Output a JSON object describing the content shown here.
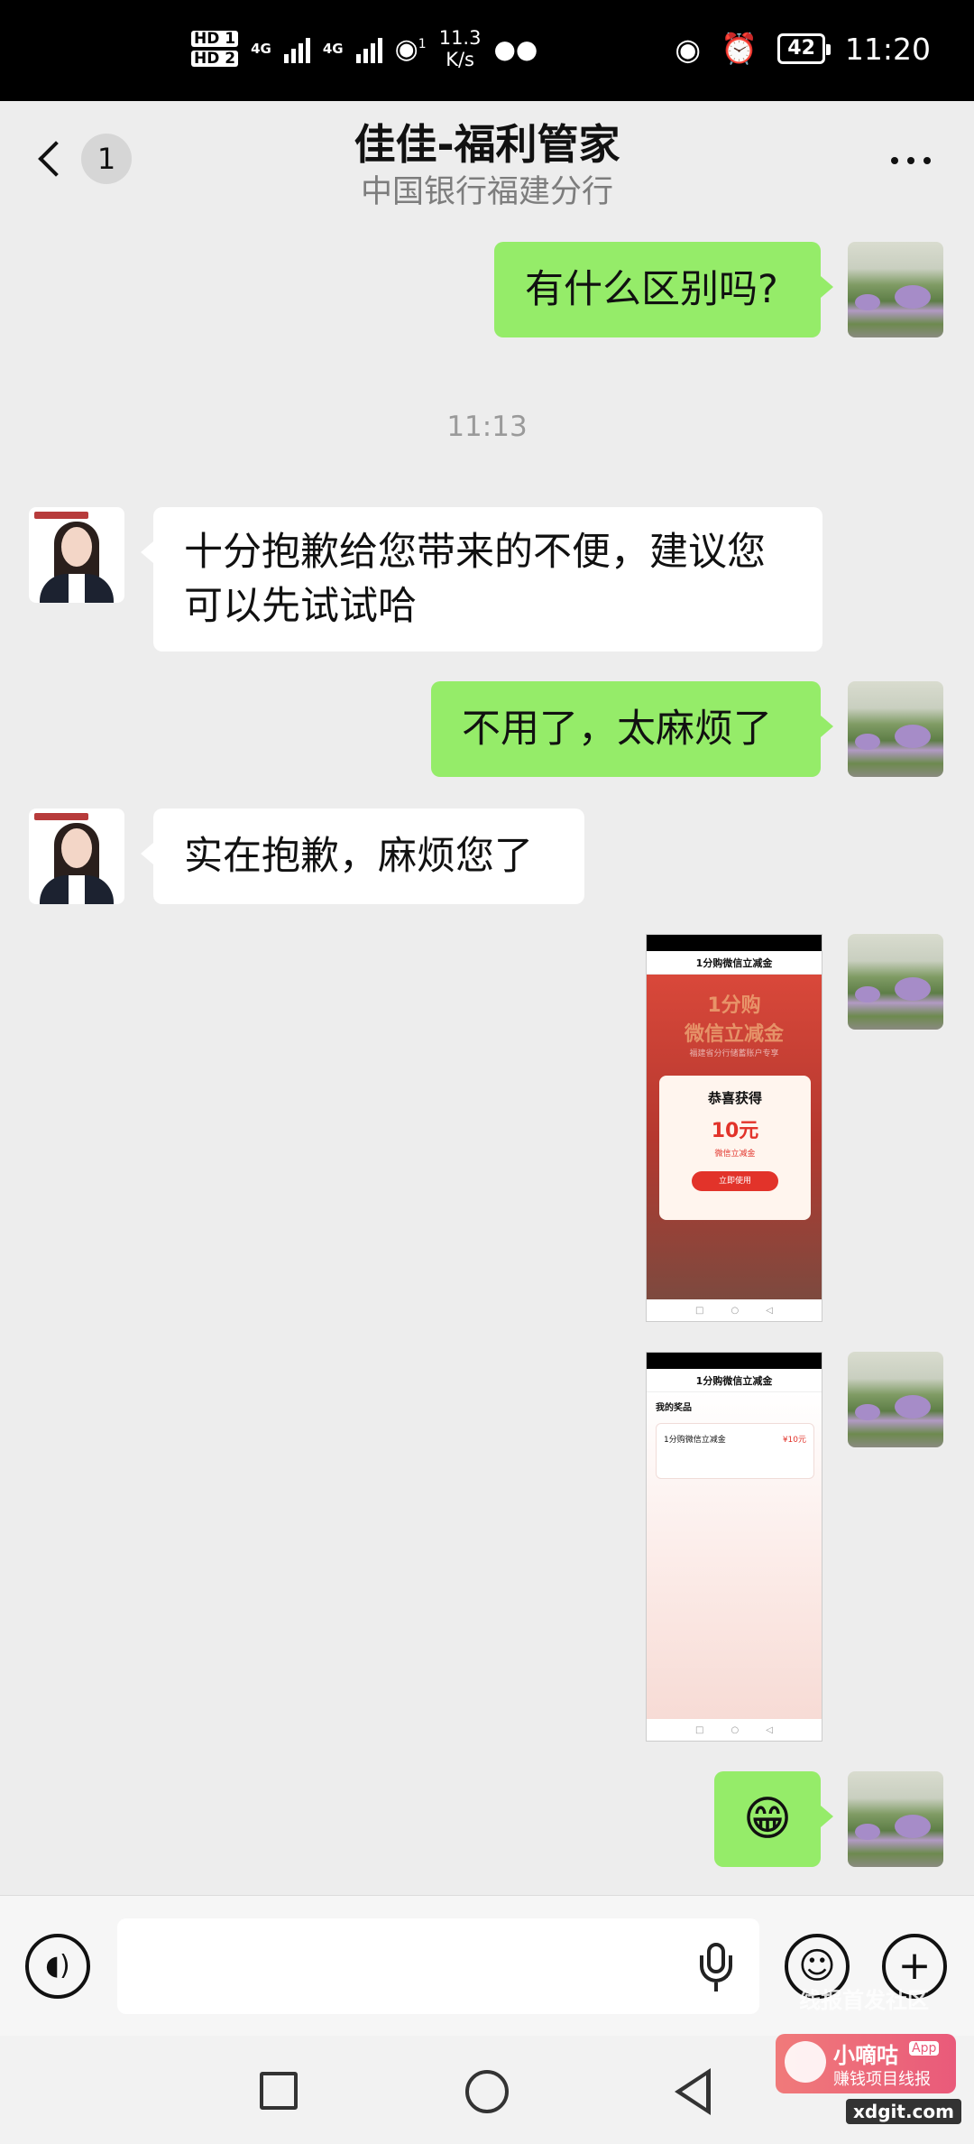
{
  "status_bar": {
    "sim1": "HD 1",
    "sim2": "HD 2",
    "net1": "4G",
    "net2": "4G",
    "hotspot_count": "1",
    "speed_value": "11.3",
    "speed_unit": "K/s",
    "battery": "42",
    "time": "11:20"
  },
  "header": {
    "unread_count": "1",
    "title": "佳佳-福利管家",
    "subtitle": "中国银行福建分行"
  },
  "timestamp": "11:13",
  "messages": [
    {
      "side": "right",
      "type": "text",
      "text": "有什么区别吗?"
    },
    {
      "side": "left",
      "type": "text",
      "line1": "十分抱歉给您带来的不便，建议您",
      "line2": "可以先试试哈"
    },
    {
      "side": "right",
      "type": "text",
      "text": "不用了，太麻烦了"
    },
    {
      "side": "left",
      "type": "text",
      "text": "实在抱歉，麻烦您了"
    },
    {
      "side": "right",
      "type": "image"
    },
    {
      "side": "right",
      "type": "image"
    },
    {
      "side": "right",
      "type": "emoji",
      "text": "😁"
    }
  ],
  "screenshot1": {
    "nav_title": "1分购微信立减金",
    "banner_line1": "1分购",
    "banner_line2": "微信立减金",
    "banner_sub": "福建省分行储蓄账户专享",
    "popup_title": "恭喜获得",
    "popup_amount": "10元",
    "popup_desc": "微信立减金",
    "popup_button": "立即使用"
  },
  "screenshot2": {
    "nav_title": "1分购微信立减金",
    "section_title": "我的奖品",
    "item_name": "1分购微信立减金",
    "item_value": "¥10元"
  },
  "input_bar": {
    "voice_icon": "voice-icon",
    "emoji_icon": "emoji-icon",
    "plus_icon": "plus-icon",
    "placeholder": ""
  },
  "watermark": {
    "line1": "线报首发社区",
    "brand": "小嘀咕",
    "app_tag": "App",
    "slogan": "赚钱项目线报",
    "domain": "xdgit.com"
  }
}
